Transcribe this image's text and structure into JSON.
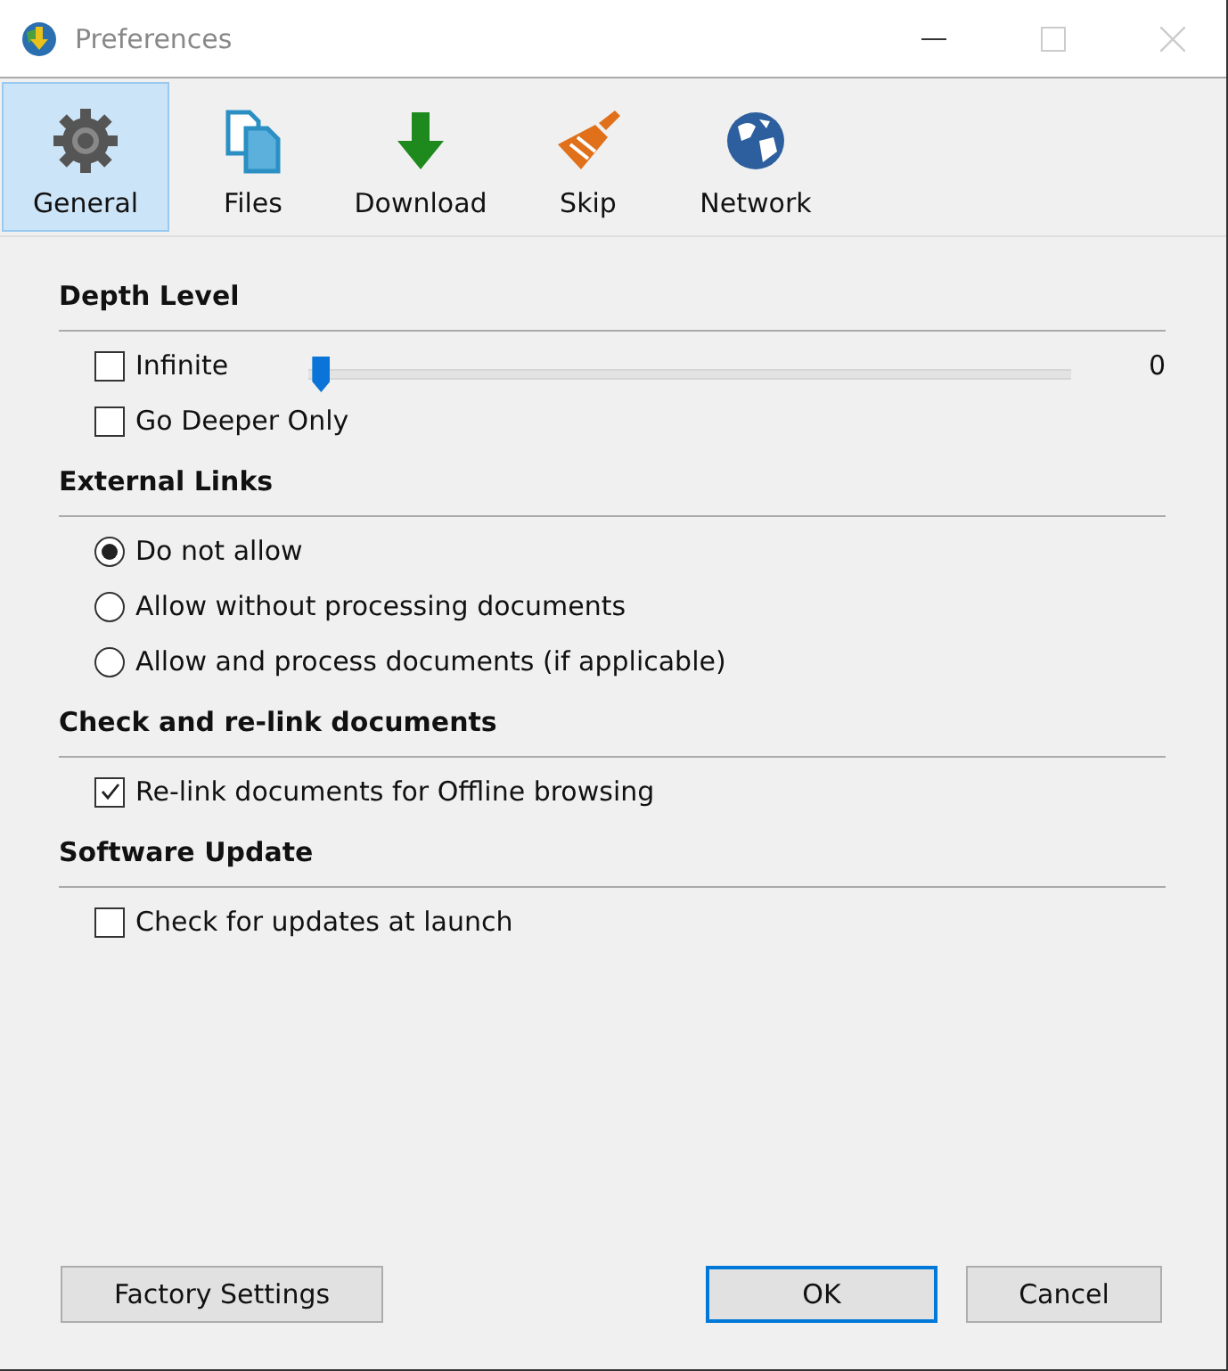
{
  "window": {
    "title": "Preferences"
  },
  "tabs": [
    {
      "label": "General",
      "selected": true
    },
    {
      "label": "Files",
      "selected": false
    },
    {
      "label": "Download",
      "selected": false
    },
    {
      "label": "Skip",
      "selected": false
    },
    {
      "label": "Network",
      "selected": false
    }
  ],
  "sections": [
    {
      "title": "Depth Level",
      "rows": [
        [
          {
            "kind": "checkbox",
            "label": "Infinite",
            "checked": false
          },
          {
            "kind": "slider",
            "level": 0,
            "reading": "0"
          }
        ],
        [
          {
            "kind": "checkbox",
            "label": "Go Deeper Only",
            "checked": false
          }
        ]
      ]
    },
    {
      "title": "External Links",
      "rows": [
        [
          {
            "kind": "radio",
            "label": "Do not allow",
            "selected": true
          }
        ],
        [
          {
            "kind": "radio",
            "label": "Allow without processing documents",
            "selected": false
          }
        ],
        [
          {
            "kind": "radio",
            "label": "Allow and process documents (if applicable)",
            "selected": false
          }
        ]
      ]
    },
    {
      "title": "Check and re-link documents",
      "rows": [
        [
          {
            "kind": "checkbox",
            "label": "Re-link documents for Offline browsing",
            "checked": true
          }
        ]
      ]
    },
    {
      "title": "Software Update",
      "rows": [
        [
          {
            "kind": "checkbox",
            "label": "Check for updates at launch",
            "checked": false
          }
        ]
      ]
    }
  ],
  "buttons": [
    {
      "label": "Factory Settings",
      "default": false
    },
    {
      "label": "OK",
      "default": true
    },
    {
      "label": "Cancel",
      "default": false
    }
  ]
}
